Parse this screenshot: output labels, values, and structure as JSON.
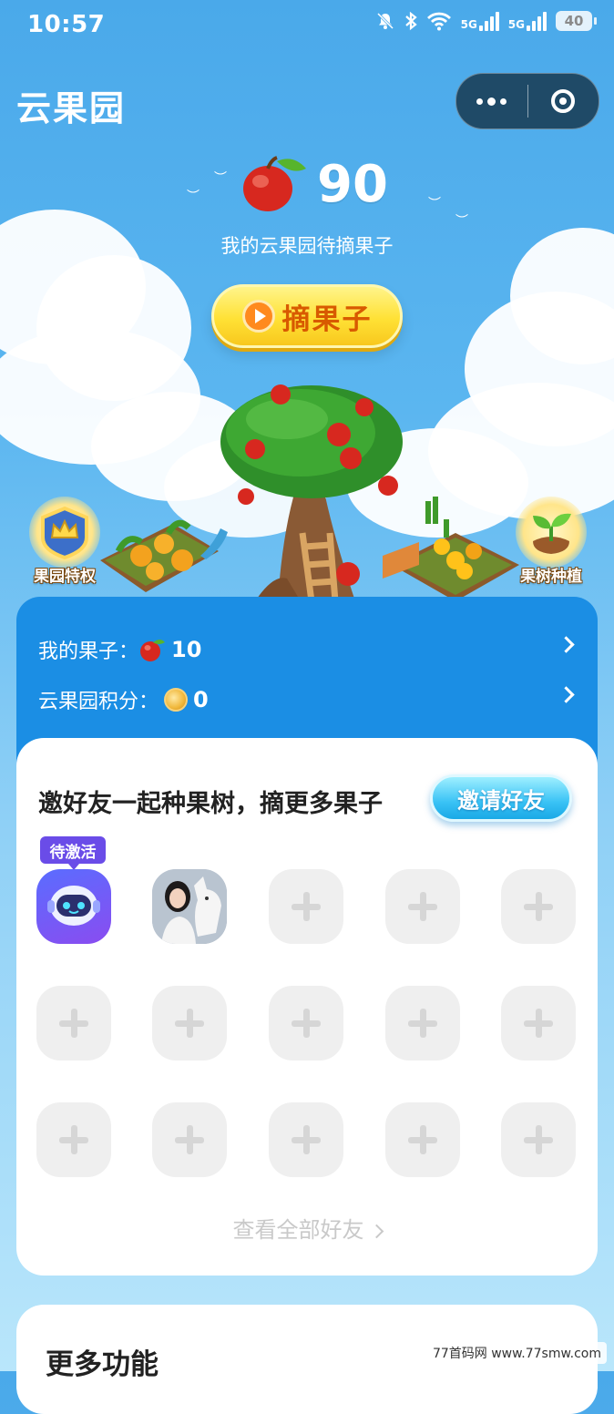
{
  "status_bar": {
    "time": "10:57",
    "signal1": "5G",
    "signal2": "5G",
    "battery": "40"
  },
  "header": {
    "title": "云果园"
  },
  "hero": {
    "fruit_count": "90",
    "subtitle": "我的云果园待摘果子",
    "pick_button": "摘果子",
    "left_badge": "果园特权",
    "right_badge": "果树种植"
  },
  "stats": [
    {
      "label": "我的果子：",
      "value": "10",
      "icon": "apple-icon"
    },
    {
      "label": "云果园积分：",
      "value": "0",
      "icon": "coin-icon"
    }
  ],
  "invite": {
    "title": "邀好友一起种果树，摘更多果子",
    "button": "邀请好友",
    "pending_tag": "待激活",
    "view_all": "查看全部好友"
  },
  "more": {
    "title": "更多功能"
  },
  "watermark": "77首码网 www.77smw.com",
  "colors": {
    "sky": "#4aa9ea",
    "panel": "#1b8ee4",
    "accent_yellow": "#ffe135",
    "tag_purple": "#6a4ce8"
  }
}
